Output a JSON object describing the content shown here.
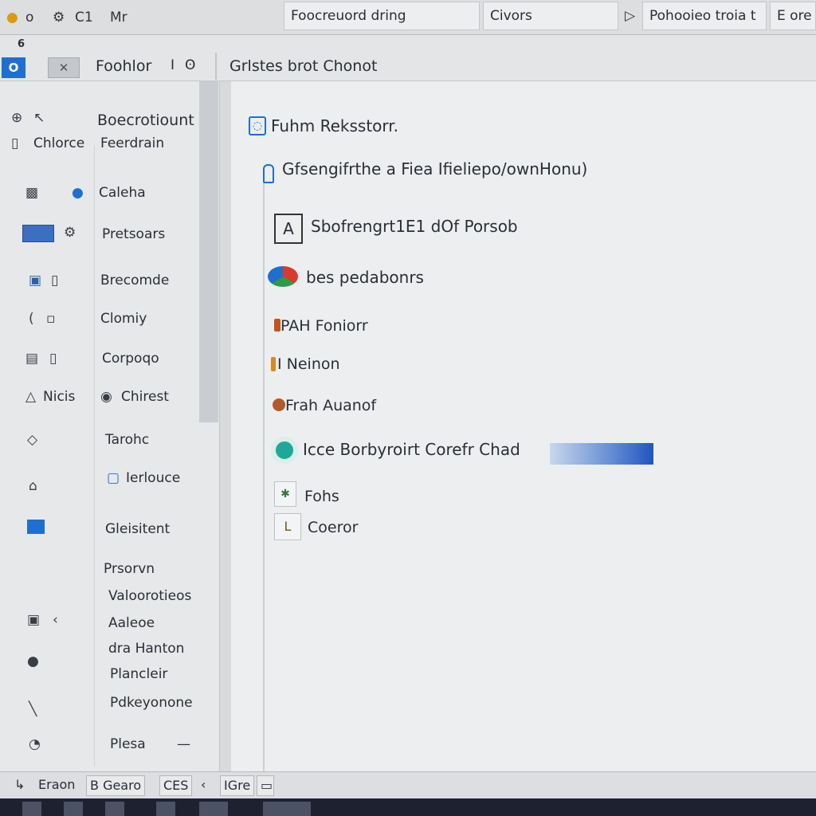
{
  "window": {
    "top_icons": [
      "o",
      "C1",
      "Mr"
    ],
    "tabs": [
      {
        "label": "Foocreuord dring"
      },
      {
        "label": "Civors"
      },
      {
        "label": "Pohooieo troia t"
      },
      {
        "label": "E ore"
      }
    ]
  },
  "toolbar": {
    "left_label": "Foohlor",
    "left_extra": "I",
    "path_label": "Grlstes brot Chonot",
    "blue_button": "O",
    "grey_button": "✕",
    "small_marks": "6"
  },
  "sidebar": {
    "header_left": "Chlorce",
    "header_right_top": "Boecrotiount",
    "header_right_bottom": "Feerdrain",
    "items": [
      {
        "label": "Caleha"
      },
      {
        "label": "Pretsoars"
      },
      {
        "label": "Brecomde"
      },
      {
        "label": "Clomiy"
      },
      {
        "label": "Corpoqo"
      },
      {
        "label": "Chirest",
        "left": "Nicis"
      },
      {
        "label": "Tarohc"
      },
      {
        "label": "Ierlouce"
      },
      {
        "label": "Gleisitent"
      },
      {
        "label": "Prsorvn"
      },
      {
        "label": "Valoorotieos"
      },
      {
        "label": "Aaleoe"
      },
      {
        "label": "dra Hanton"
      },
      {
        "label": "Plancleir"
      },
      {
        "label": "Pdkeyonone"
      },
      {
        "label": "Plesa",
        "suffix": "—"
      }
    ]
  },
  "main": {
    "title": "Fuhm Reksstorr.",
    "subtitle": "Gfsengifrthe a Fiea Ifieliepo/ownHonu)",
    "items": [
      {
        "label": "Sbofrengrt1E1 dOf Porsob"
      },
      {
        "label": "bes pedabonrs"
      },
      {
        "label": "PAH Foniorr"
      },
      {
        "label": "I Neinon"
      },
      {
        "label": "Frah Auanof"
      },
      {
        "label": "Icce Borbyroirt Corefr Chad"
      },
      {
        "label": "Fohs"
      },
      {
        "label": "Coeror"
      }
    ],
    "progress_fraction": 1.0
  },
  "statusbar": {
    "items": [
      {
        "label": "Eraon"
      },
      {
        "label": "B Gearo"
      },
      {
        "label": "CES"
      },
      {
        "label": "IGre"
      }
    ]
  },
  "colors": {
    "accent": "#1e6fd0",
    "progress": "#1f55c0",
    "background": "#eceef0"
  }
}
